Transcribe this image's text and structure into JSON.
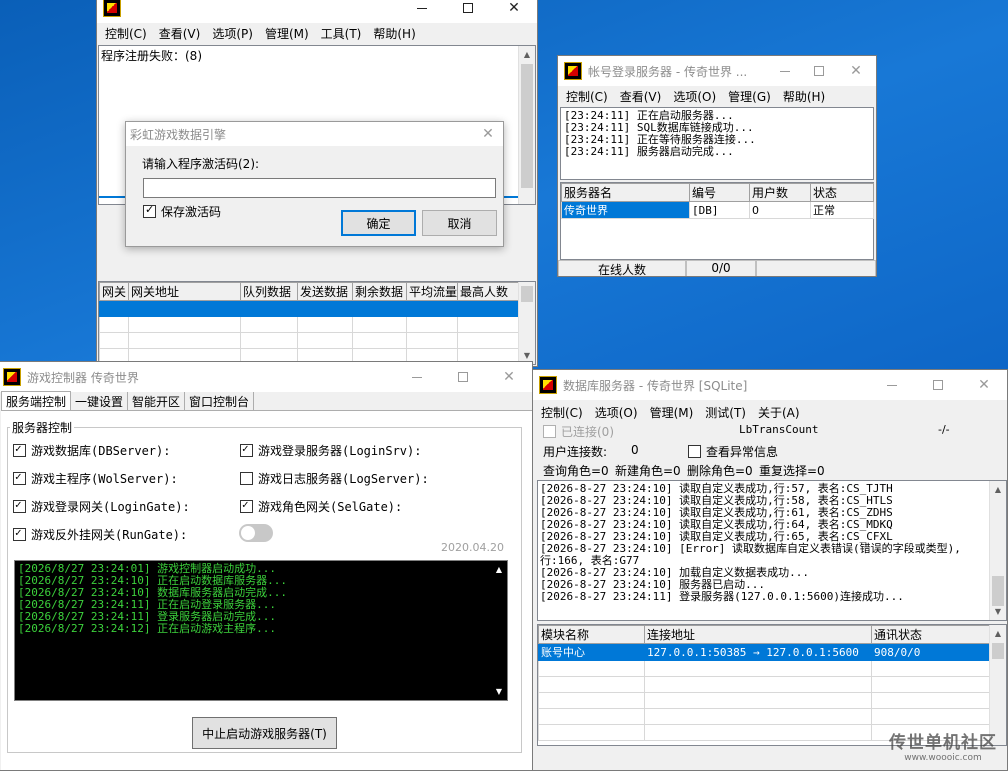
{
  "tl": {
    "menu": [
      "控制(C)",
      "查看(V)",
      "选项(P)",
      "管理(M)",
      "工具(T)",
      "帮助(H)"
    ],
    "message": "程序注册失败：(8)",
    "columns": [
      "网关",
      "网关地址",
      "队列数据",
      "发送数据",
      "剩余数据",
      "平均流量",
      "最高人数"
    ]
  },
  "dialog": {
    "title": "彩虹游戏数据引擎",
    "prompt": "请输入程序激活码(2):",
    "input_value": "",
    "save_label": "保存激活码",
    "save_checked": true,
    "ok": "确定",
    "cancel": "取消"
  },
  "acct": {
    "title": "帐号登录服务器 - 传奇世界 ...",
    "menu": [
      "控制(C)",
      "查看(V)",
      "选项(O)",
      "管理(G)",
      "帮助(H)"
    ],
    "log": [
      "[23:24:11] 正在启动服务器...",
      "[23:24:11] SQL数据库链接成功...",
      "[23:24:11] 正在等待服务器连接...",
      "[23:24:11] 服务器启动完成..."
    ],
    "columns": [
      "服务器名",
      "编号",
      "用户数",
      "状态"
    ],
    "rows": [
      [
        "传奇世界",
        "[DB]",
        "0",
        "正常"
      ]
    ],
    "status_label": "在线人数",
    "status_value": "0/0"
  },
  "game": {
    "title": "游戏控制器   传奇世界",
    "tabs": [
      "服务端控制",
      "一键设置",
      "智能开区",
      "窗口控制台"
    ],
    "group_title": "服务器控制",
    "left_checks": [
      {
        "label": "游戏数据库(DBServer):",
        "checked": true
      },
      {
        "label": "游戏主程序(WolServer):",
        "checked": true
      },
      {
        "label": "游戏登录网关(LoginGate):",
        "checked": true
      },
      {
        "label": "游戏反外挂网关(RunGate):",
        "checked": true
      }
    ],
    "right_checks": [
      {
        "label": "游戏登录服务器(LoginSrv):",
        "checked": true
      },
      {
        "label": "游戏日志服务器(LogServer):",
        "checked": false
      },
      {
        "label": "游戏角色网关(SelGate):",
        "checked": true
      }
    ],
    "toggle_on": false,
    "version": "2020.04.20",
    "log": [
      "[2026/8/27 23:24:01] 游戏控制器启动成功...",
      "[2026/8/27 23:24:10] 正在启动数据库服务器...",
      "[2026/8/27 23:24:10] 数据库服务器启动完成...",
      "[2026/8/27 23:24:11] 正在启动登录服务器...",
      "[2026/8/27 23:24:11] 登录服务器启动完成...",
      "[2026/8/27 23:24:12] 正在启动游戏主程序..."
    ],
    "stop_button": "中止启动游戏服务器(T)"
  },
  "db": {
    "title": "数据库服务器 - 传奇世界 [SQLite]",
    "menu": [
      "控制(C)",
      "选项(O)",
      "管理(M)",
      "测试(T)",
      "关于(A)"
    ],
    "connected_label": "已连接(0)",
    "trans_label": "LbTransCount",
    "trans_value": "-/-",
    "conn_count_label": "用户连接数:",
    "conn_count_value": "0",
    "view_errors": "查看异常信息",
    "stats": [
      "查询角色=0",
      "新建角色=0",
      "删除角色=0",
      "重复选择=0"
    ],
    "log": [
      "[2026-8-27 23:24:10] 读取自定义表成功,行:57, 表名:CS_TJTH",
      "[2026-8-27 23:24:10] 读取自定义表成功,行:58, 表名:CS_HTLS",
      "[2026-8-27 23:24:10] 读取自定义表成功,行:61, 表名:CS_ZDHS",
      "[2026-8-27 23:24:10] 读取自定义表成功,行:64, 表名:CS_MDKQ",
      "[2026-8-27 23:24:10] 读取自定义表成功,行:65, 表名:CS_CFXL",
      "[2026-8-27 23:24:10] [Error] 读取数据库自定义表错误(错误的字段或类型),",
      "行:166, 表名:G77",
      "[2026-8-27 23:24:10] 加载自定义数据表成功...",
      "[2026-8-27 23:24:10] 服务器已启动...",
      "[2026-8-27 23:24:11] 登录服务器(127.0.0.1:5600)连接成功..."
    ],
    "columns": [
      "模块名称",
      "连接地址",
      "通讯状态"
    ],
    "rows": [
      [
        "账号中心",
        "127.0.0.1:50385 → 127.0.0.1:5600",
        "908/0/0"
      ]
    ]
  },
  "watermark": {
    "title": "传世单机社区",
    "url": "www.woooic.com"
  }
}
